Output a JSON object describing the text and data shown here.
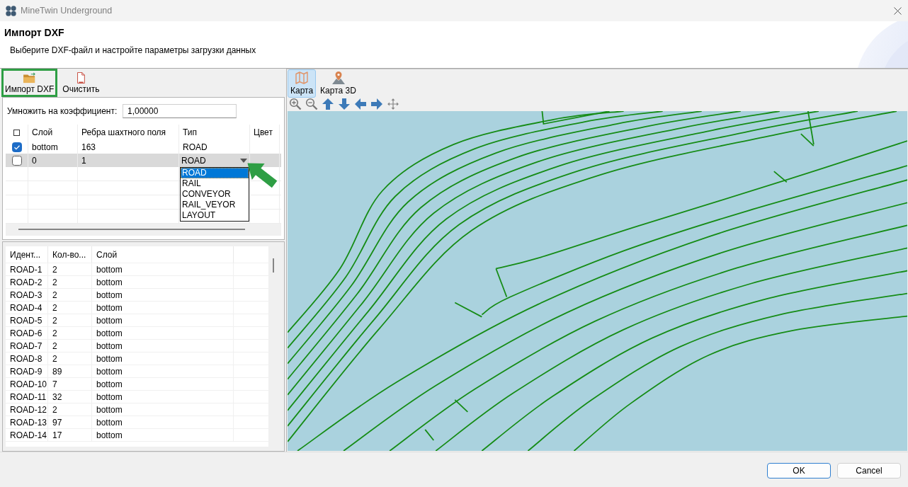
{
  "window": {
    "title": "MineTwin Underground"
  },
  "header": {
    "title": "Импорт DXF",
    "subtitle": "Выберите DXF-файл и настройте параметры загрузки данных"
  },
  "toolbar": [
    {
      "label": "Импорт DXF",
      "highlighted": true
    },
    {
      "label": "Очистить",
      "highlighted": false
    }
  ],
  "multiplier": {
    "label": "Умножить на коэффициент:",
    "value": "1,00000"
  },
  "layers_table": {
    "select_all_checked": false,
    "columns": [
      "Слой",
      "Ребра шахтного поля",
      "Тип",
      "Цвет"
    ],
    "rows": [
      {
        "checked": true,
        "selected": false,
        "layer": "bottom",
        "edges": "163",
        "type": "ROAD"
      },
      {
        "checked": false,
        "selected": true,
        "layer": "0",
        "edges": "1",
        "type": "ROAD",
        "dropdown": {
          "open": true,
          "options": [
            {
              "label": "ROAD",
              "selected": true
            },
            {
              "label": "RAIL",
              "selected": false
            },
            {
              "label": "CONVEYOR",
              "selected": false
            },
            {
              "label": "RAIL_VEYOR",
              "selected": false
            },
            {
              "label": "LAYOUT",
              "selected": false
            }
          ]
        }
      }
    ]
  },
  "elements_table": {
    "columns": [
      "Идент...",
      "Кол-во...",
      "Слой"
    ],
    "rows": [
      {
        "id": "ROAD-1",
        "count": "2",
        "layer": "bottom"
      },
      {
        "id": "ROAD-2",
        "count": "2",
        "layer": "bottom"
      },
      {
        "id": "ROAD-3",
        "count": "2",
        "layer": "bottom"
      },
      {
        "id": "ROAD-4",
        "count": "2",
        "layer": "bottom"
      },
      {
        "id": "ROAD-5",
        "count": "2",
        "layer": "bottom"
      },
      {
        "id": "ROAD-6",
        "count": "2",
        "layer": "bottom"
      },
      {
        "id": "ROAD-7",
        "count": "2",
        "layer": "bottom"
      },
      {
        "id": "ROAD-8",
        "count": "2",
        "layer": "bottom"
      },
      {
        "id": "ROAD-9",
        "count": "89",
        "layer": "bottom"
      },
      {
        "id": "ROAD-10",
        "count": "7",
        "layer": "bottom"
      },
      {
        "id": "ROAD-11",
        "count": "32",
        "layer": "bottom"
      },
      {
        "id": "ROAD-12",
        "count": "2",
        "layer": "bottom"
      },
      {
        "id": "ROAD-13",
        "count": "97",
        "layer": "bottom"
      },
      {
        "id": "ROAD-14",
        "count": "17",
        "layer": "bottom"
      }
    ]
  },
  "map_panel": {
    "tabs": [
      {
        "label": "Карта",
        "selected": true
      },
      {
        "label": "Карта 3D",
        "selected": false
      }
    ]
  },
  "buttons": [
    {
      "label": "OK",
      "default": true
    },
    {
      "label": "Cancel",
      "default": false
    }
  ]
}
